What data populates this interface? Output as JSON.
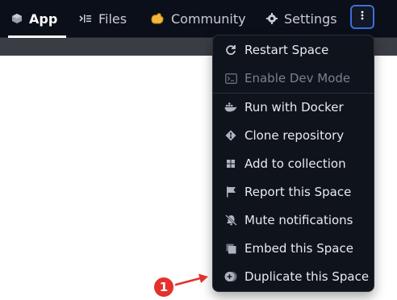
{
  "nav": {
    "tabs": [
      {
        "label": "App",
        "icon": "cube-icon",
        "active": true
      },
      {
        "label": "Files",
        "icon": "files-icon"
      },
      {
        "label": "Community",
        "icon": "hands-icon"
      },
      {
        "label": "Settings",
        "icon": "gear-icon"
      }
    ],
    "more_icon": "vertical-ellipsis-icon"
  },
  "menu": {
    "items": [
      {
        "label": "Restart Space",
        "icon": "restart-icon",
        "enabled": true
      },
      {
        "label": "Enable Dev Mode",
        "icon": "terminal-icon",
        "enabled": false
      },
      {
        "label": "Run with Docker",
        "icon": "docker-icon",
        "enabled": true
      },
      {
        "label": "Clone repository",
        "icon": "git-icon",
        "enabled": true
      },
      {
        "label": "Add to collection",
        "icon": "collection-icon",
        "enabled": true
      },
      {
        "label": "Report this Space",
        "icon": "flag-icon",
        "enabled": true
      },
      {
        "label": "Mute notifications",
        "icon": "mute-bell-icon",
        "enabled": true
      },
      {
        "label": "Embed this Space",
        "icon": "embed-icon",
        "enabled": true
      },
      {
        "label": "Duplicate this Space",
        "icon": "duplicate-icon",
        "enabled": true
      }
    ]
  },
  "annotation": {
    "badge": "1",
    "color": "#e4312c"
  },
  "colors": {
    "topbar_bg": "#0b0f19",
    "menu_bg": "#0f131c",
    "focus_ring": "#3b6fd8"
  }
}
